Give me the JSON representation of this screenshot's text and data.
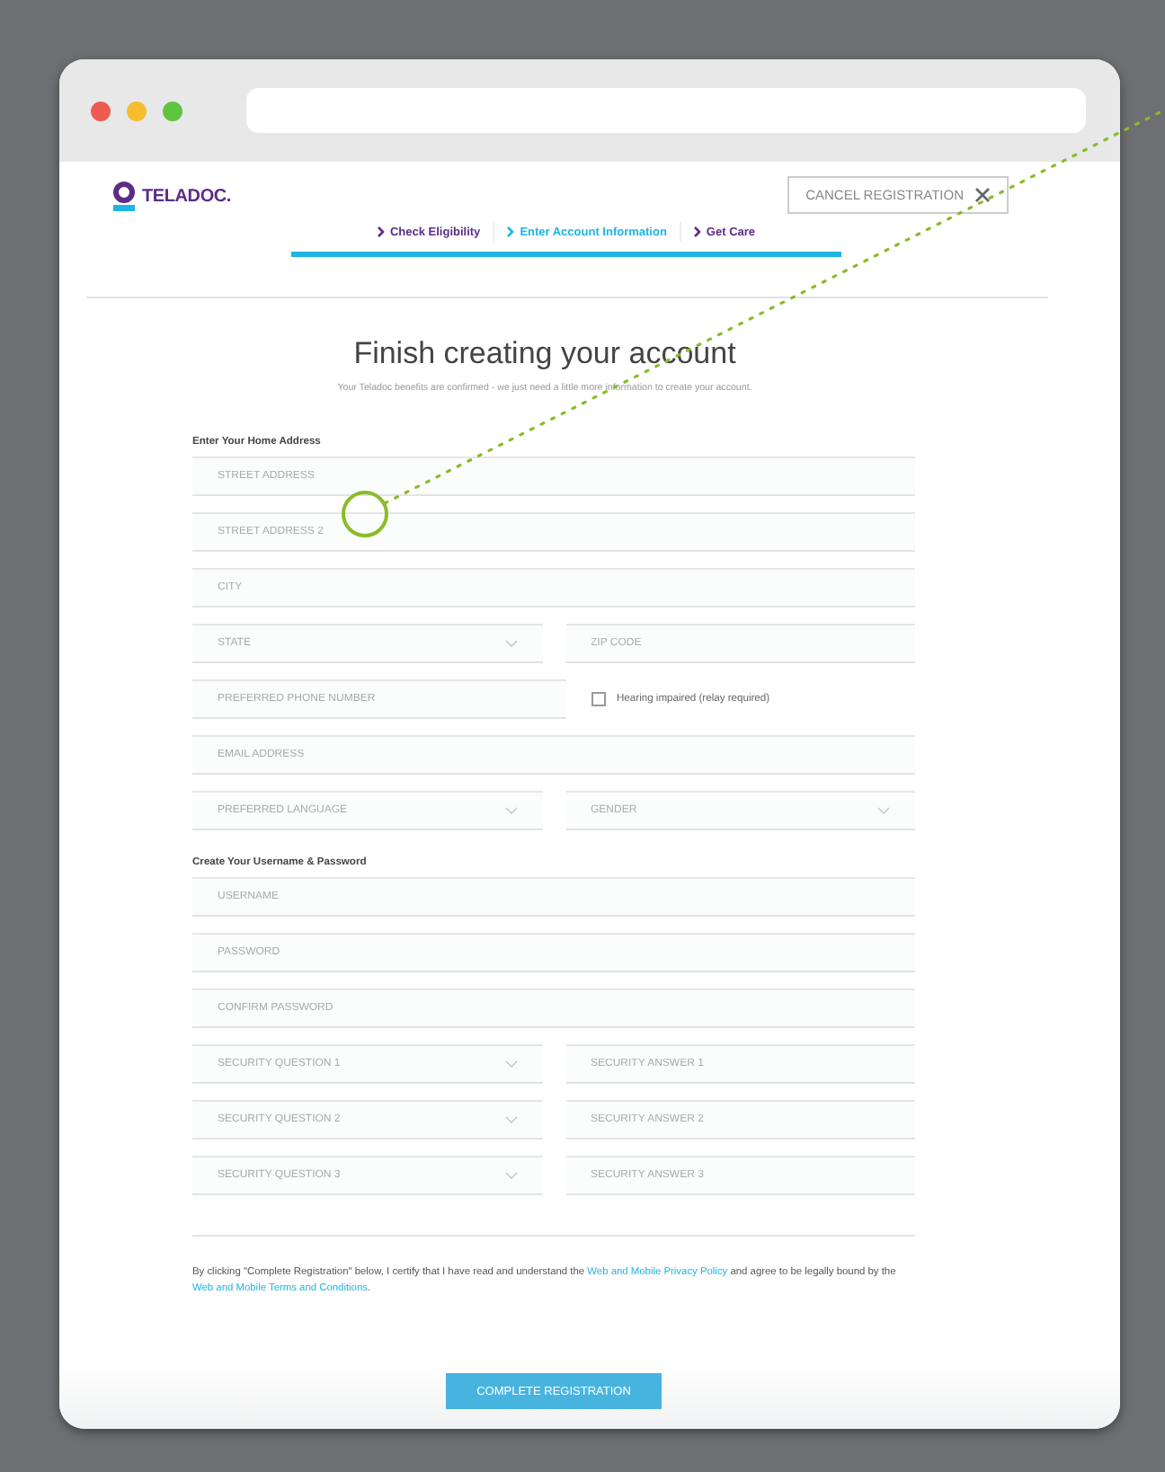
{
  "header": {
    "logo": "TELADOC.",
    "cancel_button": "CANCEL REGISTRATION"
  },
  "steps": [
    {
      "label": "Check Eligibility",
      "selected": false
    },
    {
      "label": "Enter Account Information",
      "selected": true
    },
    {
      "label": "Get Care",
      "selected": false
    }
  ],
  "progress": {
    "level": 1
  },
  "title": "Finish creating your account",
  "subtitle": "Your Teladoc benefits are confirmed - we just need a little more information to create your account.",
  "sections": [
    {
      "heading": "Enter Your Home Address",
      "rows": [
        [
          {
            "kind": "input",
            "placeholder": "STREET ADDRESS"
          }
        ],
        [
          {
            "kind": "input",
            "placeholder": "STREET ADDRESS 2"
          }
        ],
        [
          {
            "kind": "input",
            "placeholder": "CITY"
          }
        ],
        [
          {
            "kind": "select",
            "placeholder": "STATE"
          },
          {
            "kind": "input",
            "placeholder": "ZIP CODE"
          }
        ],
        [
          {
            "kind": "input",
            "placeholder": "PREFERRED PHONE NUMBER"
          },
          {
            "kind": "checkbox",
            "label": "Hearing impaired (relay required)",
            "checked": false
          }
        ],
        [
          {
            "kind": "input",
            "placeholder": "EMAIL ADDRESS"
          }
        ],
        [
          {
            "kind": "select",
            "placeholder": "PREFERRED LANGUAGE"
          },
          {
            "kind": "select",
            "placeholder": "GENDER"
          }
        ]
      ]
    },
    {
      "heading": "Create Your Username & Password",
      "rows": [
        [
          {
            "kind": "input",
            "placeholder": "USERNAME"
          }
        ],
        [
          {
            "kind": "input",
            "placeholder": "PASSWORD"
          }
        ],
        [
          {
            "kind": "input",
            "placeholder": "CONFIRM PASSWORD"
          }
        ],
        [
          {
            "kind": "select",
            "placeholder": "SECURITY QUESTION 1"
          },
          {
            "kind": "input",
            "placeholder": "SECURITY ANSWER 1"
          }
        ],
        [
          {
            "kind": "select",
            "placeholder": "SECURITY QUESTION 2"
          },
          {
            "kind": "input",
            "placeholder": "SECURITY ANSWER 2"
          }
        ],
        [
          {
            "kind": "select",
            "placeholder": "SECURITY QUESTION 3"
          },
          {
            "kind": "input",
            "placeholder": "SECURITY ANSWER 3"
          }
        ]
      ]
    }
  ],
  "legal": [
    {
      "kind": "text",
      "text": "By clicking \"Complete Registration\" below, I certify that I have read and understand the "
    },
    {
      "kind": "link",
      "text": "Web and Mobile Privacy Policy"
    },
    {
      "kind": "text",
      "text": " and agree to be legally bound by the "
    },
    {
      "kind": "link",
      "text": "Web and Mobile Terms and Conditions"
    },
    {
      "kind": "text",
      "text": "."
    }
  ],
  "submit_button": "COMPLETE REGISTRATION"
}
